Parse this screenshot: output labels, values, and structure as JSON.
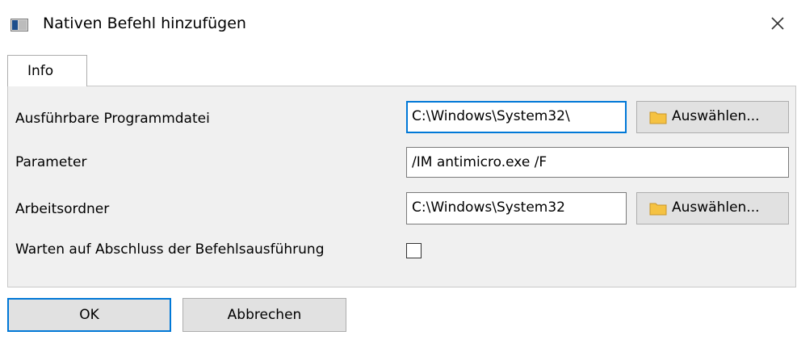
{
  "window": {
    "title": "Nativen Befehl hinzufügen",
    "icon": "app-window-icon",
    "close_icon": "close-icon"
  },
  "tabs": [
    {
      "label": "Info",
      "selected": true
    }
  ],
  "form": {
    "executable": {
      "label": "Ausführbare Programmdatei",
      "value": "C:\\Windows\\System32\\",
      "browse_label": "Auswählen..."
    },
    "parameter": {
      "label": "Parameter",
      "value": "/IM antimicro.exe /F"
    },
    "working_dir": {
      "label": "Arbeitsordner",
      "value": "C:\\Windows\\System32",
      "browse_label": "Auswählen..."
    },
    "wait": {
      "label": "Warten auf Abschluss der Befehlsausführung",
      "checked": false
    }
  },
  "buttons": {
    "ok": "OK",
    "cancel": "Abbrechen"
  },
  "colors": {
    "accent": "#0078d7",
    "panel_bg": "#f0f0f0",
    "button_bg": "#e1e1e1",
    "folder": "#f5c242"
  }
}
